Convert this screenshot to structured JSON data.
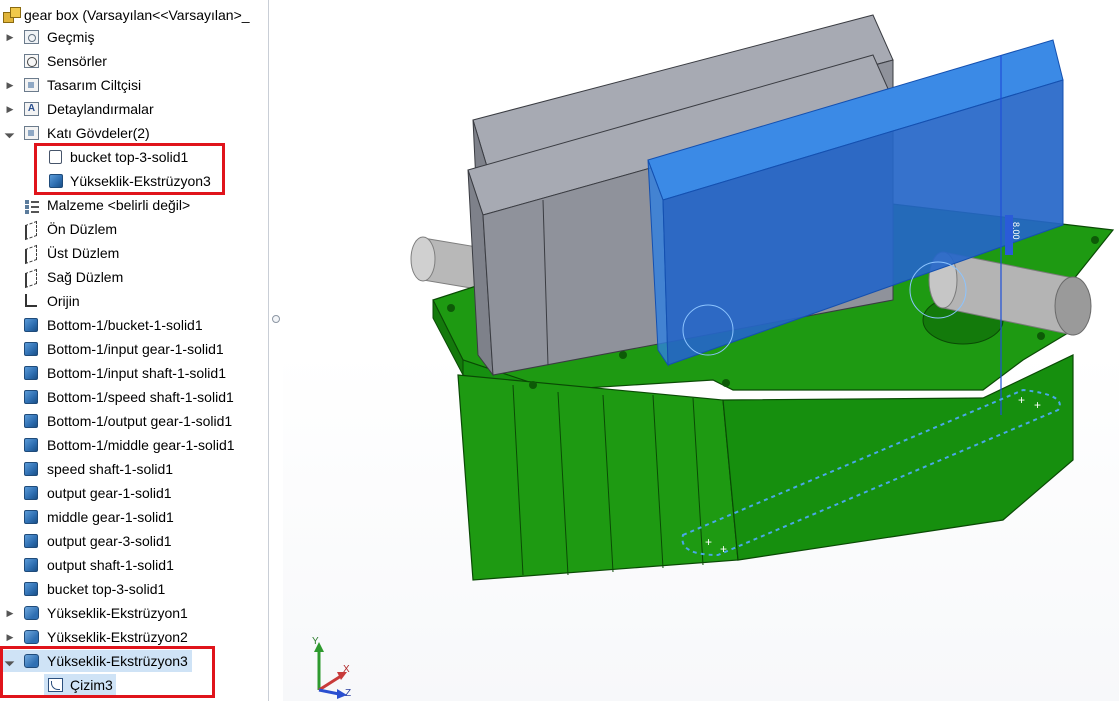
{
  "tree": {
    "root_label": "gear box  (Varsayılan<<Varsayılan>_",
    "items": [
      {
        "label": "Geçmiş",
        "icon": "history-icon"
      },
      {
        "label": "Sensörler",
        "icon": "sensors-icon"
      },
      {
        "label": "Tasarım Ciltçisi",
        "icon": "design-binder-icon"
      },
      {
        "label": "Detaylandırmalar",
        "icon": "annotations-icon"
      },
      {
        "label": "Katı Gövdeler(2)",
        "icon": "solid-bodies-folder-icon"
      },
      {
        "label": "bucket top-3-solid1",
        "icon": "solid-body-outline-icon"
      },
      {
        "label": "Yükseklik-Ekstrüzyon3",
        "icon": "solid-body-icon"
      },
      {
        "label": "Malzeme <belirli değil>",
        "icon": "material-icon"
      },
      {
        "label": "Ön Düzlem",
        "icon": "plane-icon"
      },
      {
        "label": "Üst Düzlem",
        "icon": "plane-icon"
      },
      {
        "label": "Sağ Düzlem",
        "icon": "plane-icon"
      },
      {
        "label": "Orijin",
        "icon": "origin-icon"
      },
      {
        "label": "Bottom-1/bucket-1-solid1",
        "icon": "imported-body-icon"
      },
      {
        "label": "Bottom-1/input gear-1-solid1",
        "icon": "imported-body-icon"
      },
      {
        "label": "Bottom-1/input shaft-1-solid1",
        "icon": "imported-body-icon"
      },
      {
        "label": "Bottom-1/speed shaft-1-solid1",
        "icon": "imported-body-icon"
      },
      {
        "label": "Bottom-1/output gear-1-solid1",
        "icon": "imported-body-icon"
      },
      {
        "label": "Bottom-1/middle gear-1-solid1",
        "icon": "imported-body-icon"
      },
      {
        "label": "speed shaft-1-solid1",
        "icon": "imported-body-icon"
      },
      {
        "label": "output gear-1-solid1",
        "icon": "imported-body-icon"
      },
      {
        "label": "middle gear-1-solid1",
        "icon": "imported-body-icon"
      },
      {
        "label": "output gear-3-solid1",
        "icon": "imported-body-icon"
      },
      {
        "label": "output shaft-1-solid1",
        "icon": "imported-body-icon"
      },
      {
        "label": "bucket top-3-solid1",
        "icon": "imported-body-icon"
      },
      {
        "label": "Yükseklik-Ekstrüzyon1",
        "icon": "extrude-feature-icon"
      },
      {
        "label": "Yükseklik-Ekstrüzyon2",
        "icon": "extrude-feature-icon"
      },
      {
        "label": "Yükseklik-Ekstrüzyon3",
        "icon": "extrude-feature-icon"
      },
      {
        "label": "Çizim3",
        "icon": "sketch-icon"
      }
    ]
  },
  "viewport": {
    "triad": {
      "x_label": "X",
      "y_label": "Y",
      "z_label": "Z"
    },
    "dimension_text": "8.00",
    "colors": {
      "housing": "#1e9a12",
      "housing_dark": "#137a0b",
      "blocks": "#8f929b",
      "selected_body": "#2f7fe0",
      "shaft": "#b8b8b8",
      "highlight_box": "#e0141b"
    }
  }
}
